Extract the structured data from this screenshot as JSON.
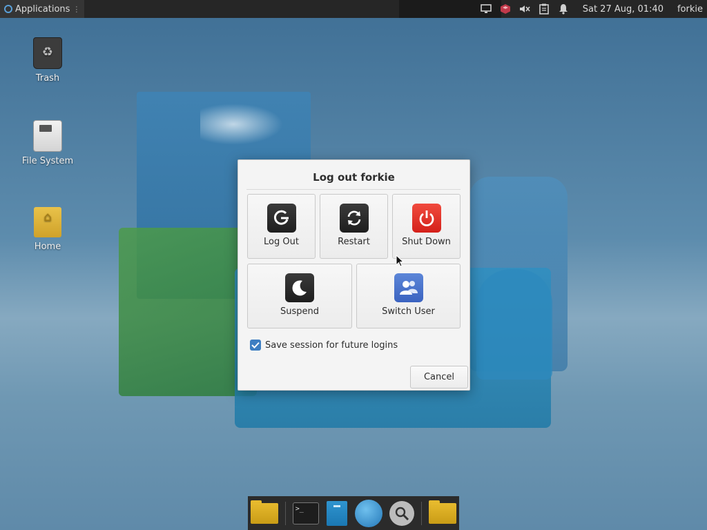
{
  "top_panel": {
    "applications_label": "Applications",
    "tray_icons": [
      "display-icon",
      "package-updates-icon",
      "volume-muted-icon",
      "clipboard-icon",
      "notification-bell-icon"
    ],
    "clock": "Sat 27 Aug, 01:40",
    "user": "forkie"
  },
  "desktop_icons": {
    "trash": "Trash",
    "filesystem": "File System",
    "home": "Home"
  },
  "dialog": {
    "title": "Log out forkie",
    "actions": {
      "logout": "Log Out",
      "restart": "Restart",
      "shutdown": "Shut Down",
      "suspend": "Suspend",
      "switch_user": "Switch User"
    },
    "save_session_label": "Save session for future logins",
    "save_session_checked": true,
    "cancel_label": "Cancel"
  },
  "dock": {
    "items": [
      "folder-icon",
      "terminal-icon",
      "text-editor-icon",
      "web-browser-icon",
      "search-icon",
      "folder-icon"
    ]
  },
  "colors": {
    "panel_bg": "#262626",
    "shutdown_red": "#e2332b",
    "switch_user_blue": "#4a73cc",
    "checkbox_blue": "#3d7ec2"
  }
}
